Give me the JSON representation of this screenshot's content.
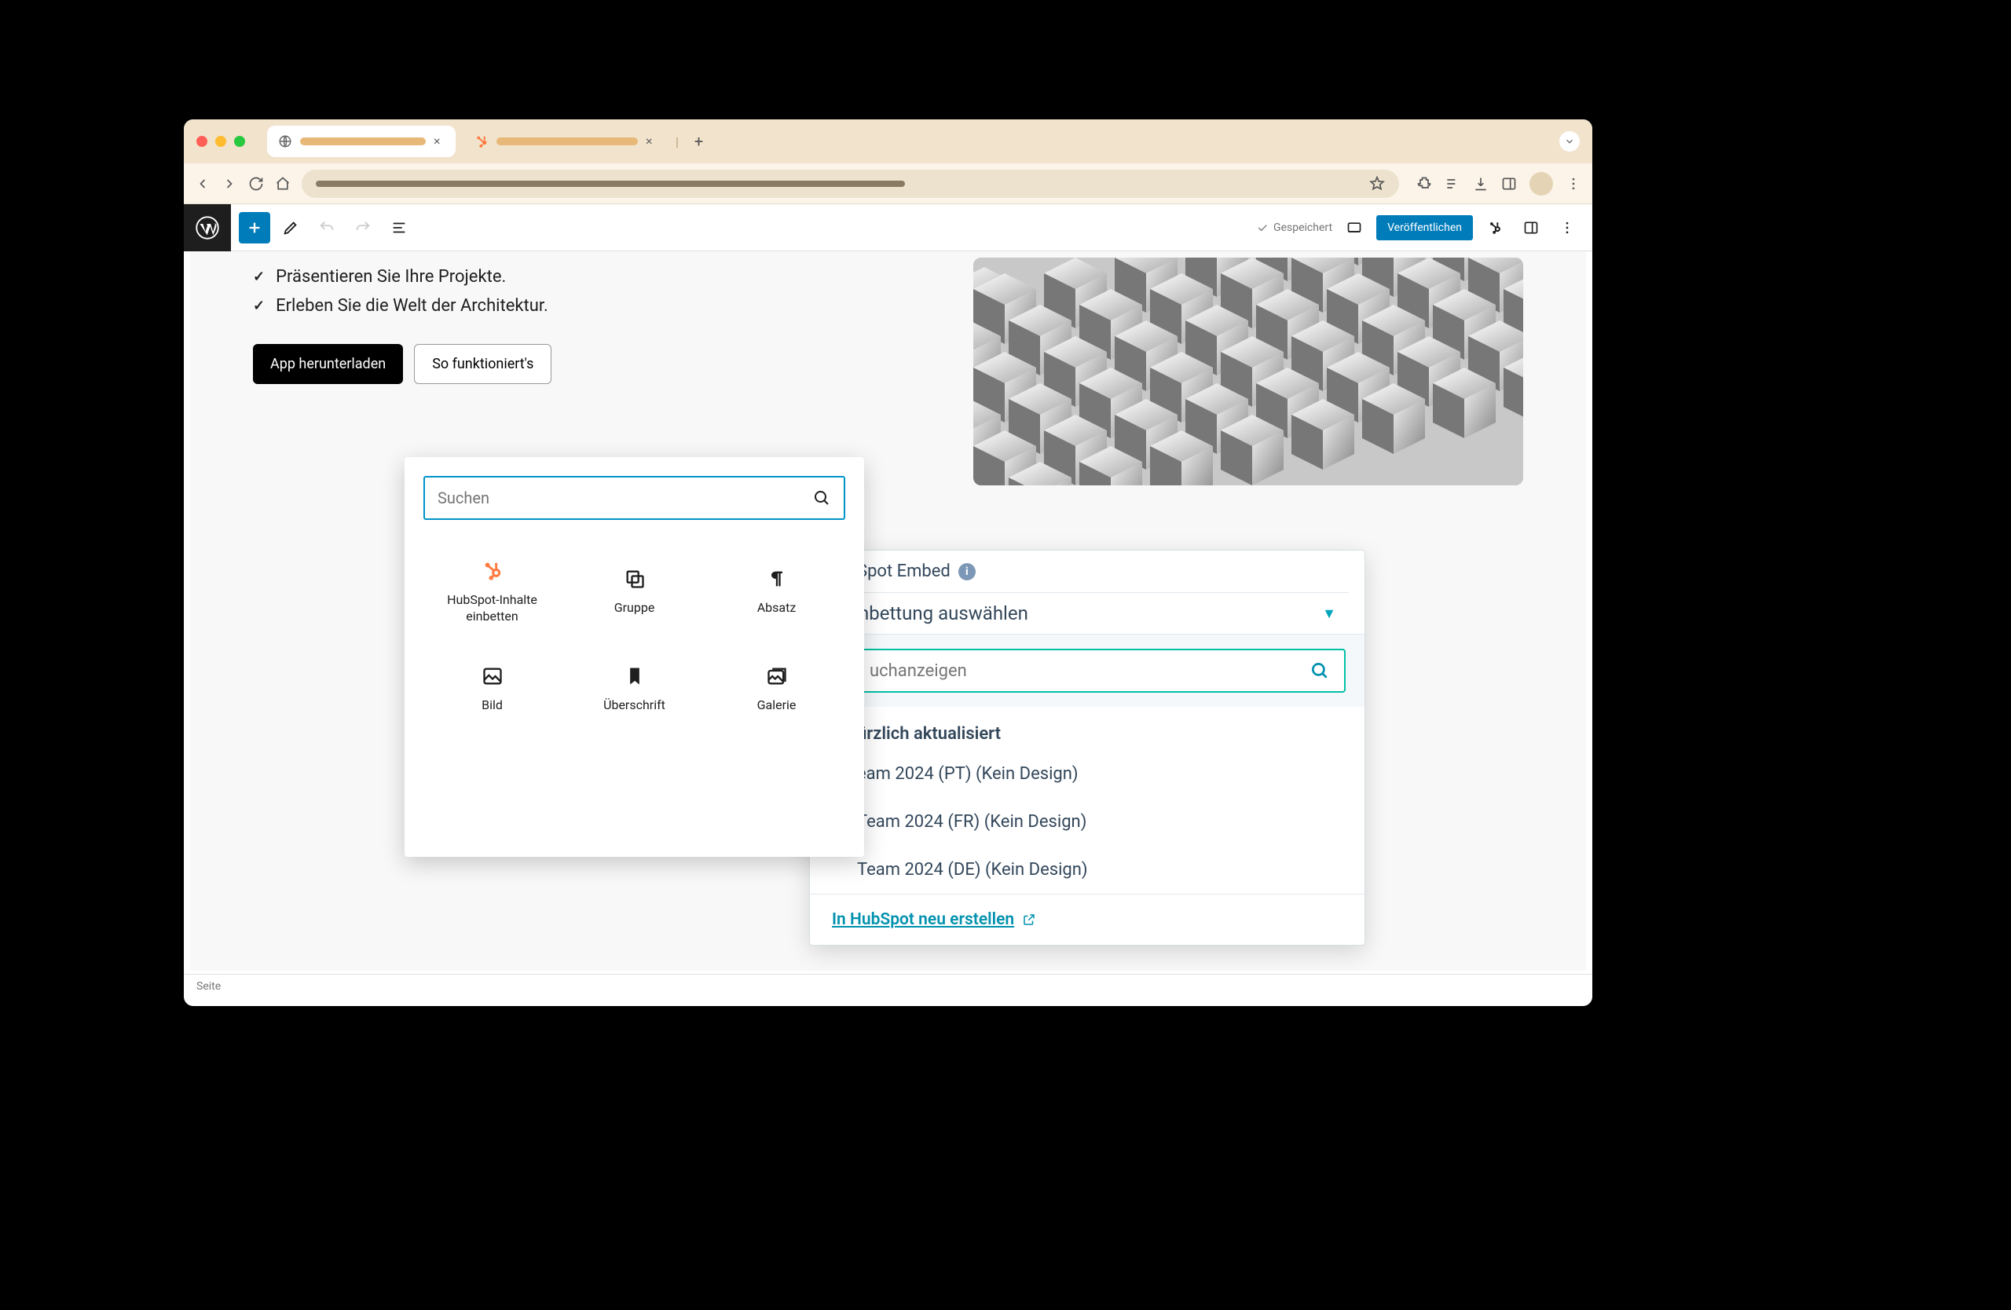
{
  "browser": {
    "tabs": [
      {
        "favicon": "globe",
        "active": true
      },
      {
        "favicon": "hubspot",
        "active": false
      }
    ]
  },
  "wp_toolbar": {
    "saved_label": "Gespeichert",
    "publish_label": "Veröffentlichen"
  },
  "content": {
    "bullets": [
      "Präsentieren Sie Ihre Projekte.",
      "Erleben Sie die Welt der Architektur."
    ],
    "btn_primary": "App herunterladen",
    "btn_secondary": "So funktioniert's"
  },
  "inserter": {
    "search_placeholder": "Suchen",
    "blocks": [
      {
        "icon": "hubspot",
        "label": "HubSpot-Inhalte einbetten"
      },
      {
        "icon": "group",
        "label": "Gruppe"
      },
      {
        "icon": "paragraph",
        "label": "Absatz"
      },
      {
        "icon": "image",
        "label": "Bild"
      },
      {
        "icon": "heading",
        "label": "Überschrift"
      },
      {
        "icon": "gallery",
        "label": "Galerie"
      }
    ]
  },
  "hubspot": {
    "title": "Spot Embed",
    "select_label": "nbettung auswählen",
    "search_placeholder": "uchanzeigen",
    "section_title": "ürzlich aktualisiert",
    "items": [
      "eam 2024 (PT) (Kein Design)",
      "Team 2024 (FR) (Kein Design)",
      "Team 2024 (DE) (Kein Design)"
    ],
    "footer_link": "In HubSpot neu erstellen"
  },
  "status_bar": "Seite"
}
